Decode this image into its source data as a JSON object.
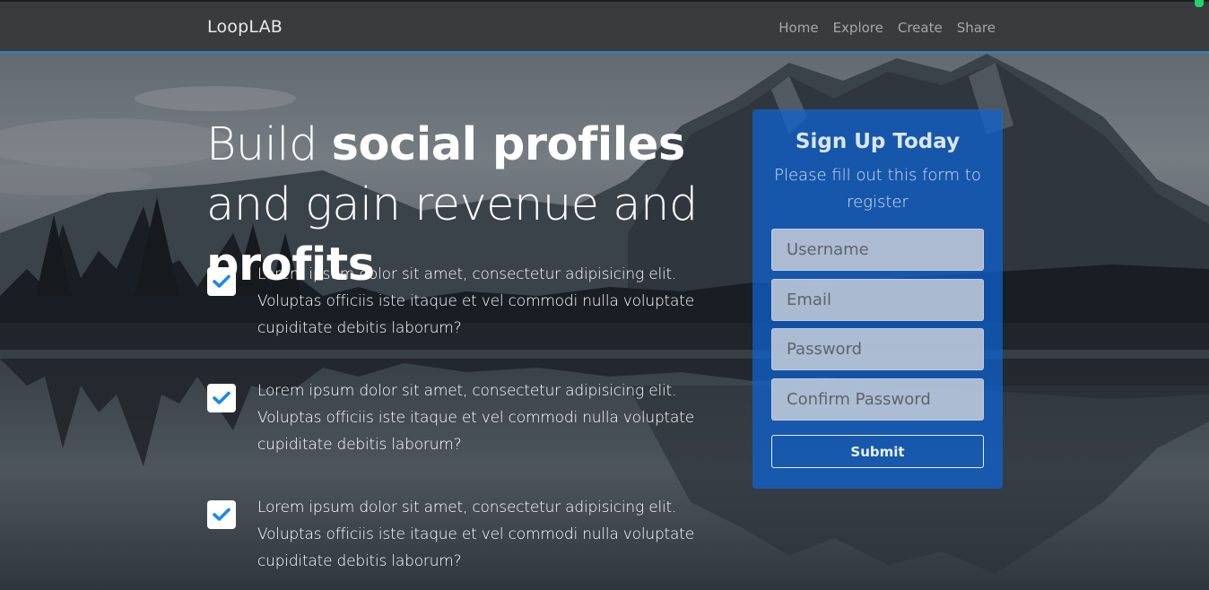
{
  "nav": {
    "brand": "LoopLAB",
    "links": [
      "Home",
      "Explore",
      "Create",
      "Share"
    ]
  },
  "hero": {
    "title_parts": [
      "Build ",
      "social profiles",
      " and gain revenue and ",
      "profits"
    ]
  },
  "features": [
    {
      "text": "Lorem ipsum dolor sit amet, consectetur adipisicing elit. Voluptas officiis iste itaque et vel commodi nulla voluptate cupiditate debitis laborum?"
    },
    {
      "text": "Lorem ipsum dolor sit amet, consectetur adipisicing elit. Voluptas officiis iste itaque et vel commodi nulla voluptate cupiditate debitis laborum?"
    },
    {
      "text": "Lorem ipsum dolor sit amet, consectetur adipisicing elit. Voluptas officiis iste itaque et vel commodi nulla voluptate cupiditate debitis laborum?"
    }
  ],
  "signup": {
    "title": "Sign Up Today",
    "subtitle": "Please fill out this form to register",
    "fields": {
      "username_placeholder": "Username",
      "email_placeholder": "Email",
      "password_placeholder": "Password",
      "confirm_placeholder": "Confirm Password"
    },
    "submit_label": "Submit"
  },
  "colors": {
    "accent": "#2f84c4",
    "card": "#0d64d6",
    "check": "#1e88e5",
    "navbar": "#3a3b3d"
  }
}
